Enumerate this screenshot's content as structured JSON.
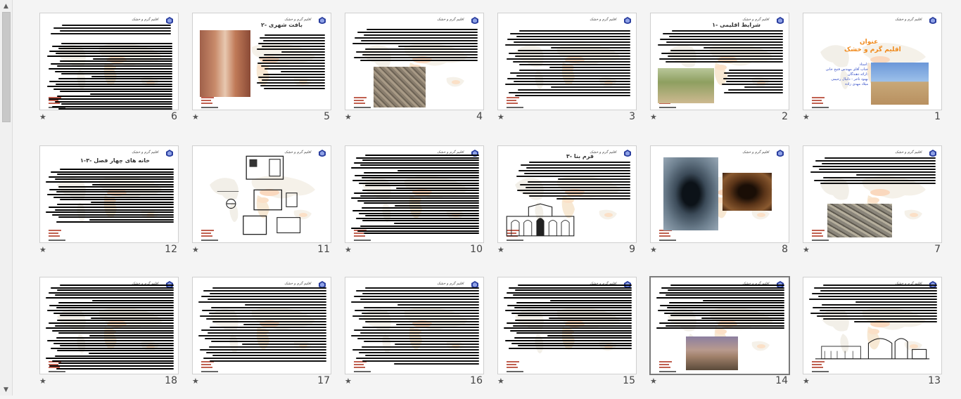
{
  "view": {
    "name": "slide-sorter",
    "selected_slide": 14
  },
  "slides": [
    {
      "number": "1",
      "star": "★"
    },
    {
      "number": "2",
      "star": "★",
      "title": "۱- شرایط اقلیمی"
    },
    {
      "number": "3",
      "star": "★"
    },
    {
      "number": "4",
      "star": "★"
    },
    {
      "number": "5",
      "star": "★",
      "title": "۲- بافت شهری"
    },
    {
      "number": "6",
      "star": "★"
    },
    {
      "number": "7",
      "star": "★"
    },
    {
      "number": "8",
      "star": "★"
    },
    {
      "number": "9",
      "star": "★",
      "title": "۳- فرم بنا"
    },
    {
      "number": "10",
      "star": "★"
    },
    {
      "number": "11",
      "star": "★"
    },
    {
      "number": "12",
      "star": "★",
      "title": "۱-۳- خانه های چهار فصل"
    },
    {
      "number": "13",
      "star": "★"
    },
    {
      "number": "14",
      "star": "★"
    },
    {
      "number": "15",
      "star": "★"
    },
    {
      "number": "16",
      "star": "★"
    },
    {
      "number": "17",
      "star": "★"
    },
    {
      "number": "18",
      "star": "★"
    }
  ],
  "slide1": {
    "title_top": "عنوان",
    "title_main": "اقلیم گرم و خشک",
    "teacher_label": "استاد:",
    "teacher": "جناب آقای مهندس فتیح خانی",
    "students_label": "ارائه دهندگان:",
    "student1": "بهنود تاجر - دانیال رحیمی",
    "student2": "میلاد مهدی زاده"
  },
  "header_text": "اقلیم گرم و خشک",
  "colors": {
    "accent_orange": "#f08a1c",
    "accent_blue": "#2d48c6",
    "selected_border": "#7a7a7a"
  }
}
